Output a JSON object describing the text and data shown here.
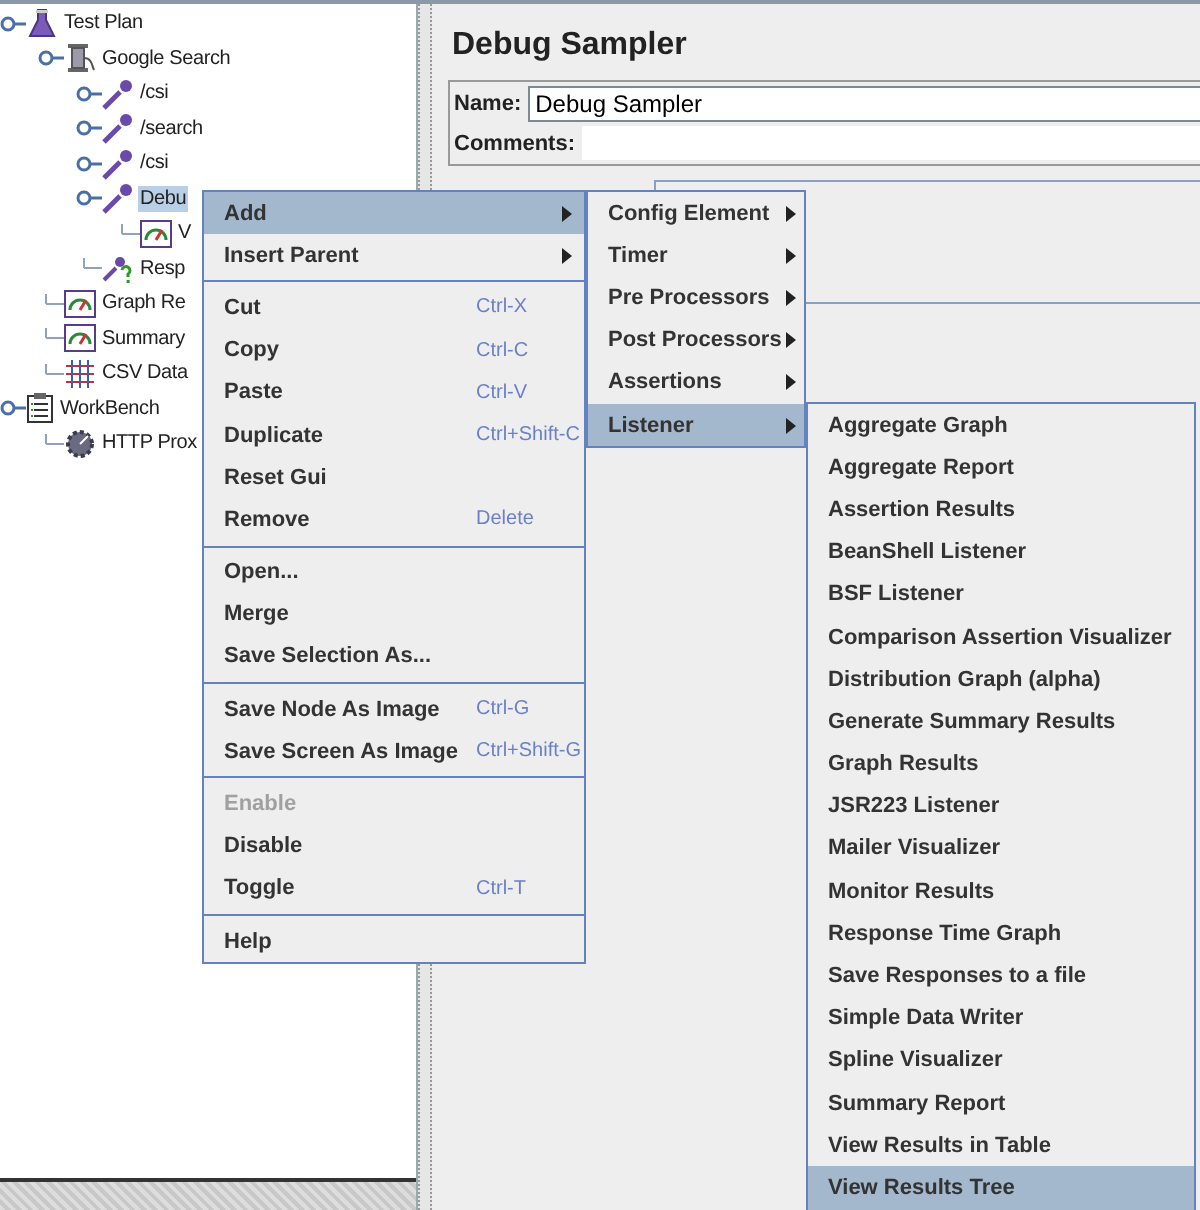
{
  "tree": [
    {
      "label": "Test Plan",
      "kind": "plan",
      "expandable": true,
      "selected": false,
      "children": [
        {
          "label": "Google Search",
          "kind": "thread-group",
          "expandable": true,
          "selected": false,
          "children": [
            {
              "label": "/csi",
              "kind": "sampler",
              "expandable": true,
              "selected": false
            },
            {
              "label": "/search",
              "kind": "sampler",
              "expandable": true,
              "selected": false
            },
            {
              "label": "/csi",
              "kind": "sampler",
              "expandable": true,
              "selected": false
            },
            {
              "label": "Debu",
              "kind": "sampler",
              "expandable": true,
              "selected": true,
              "children": [
                {
                  "label": "V",
                  "kind": "listener",
                  "expandable": false,
                  "selected": false
                }
              ]
            },
            {
              "label": "Resp",
              "kind": "assertion",
              "expandable": false,
              "selected": false
            }
          ]
        },
        {
          "label": "Graph Re",
          "kind": "listener",
          "expandable": false,
          "selected": false
        },
        {
          "label": "Summary",
          "kind": "listener",
          "expandable": false,
          "selected": false
        },
        {
          "label": "CSV Data",
          "kind": "config",
          "expandable": false,
          "selected": false
        }
      ]
    },
    {
      "label": "WorkBench",
      "kind": "workbench",
      "expandable": true,
      "selected": false,
      "children": [
        {
          "label": "HTTP Prox",
          "kind": "proxy",
          "expandable": false,
          "selected": false
        }
      ]
    }
  ],
  "editor": {
    "title": "Debug Sampler",
    "name_label": "Name:",
    "name_value": "Debug Sampler",
    "comments_label": "Comments:"
  },
  "context_menu": {
    "groups": [
      [
        {
          "label": "Add",
          "submenu": true,
          "disabled": false,
          "selected": true
        },
        {
          "label": "Insert Parent",
          "submenu": true,
          "disabled": false,
          "selected": false
        }
      ],
      [
        {
          "label": "Cut",
          "shortcut": "Ctrl-X",
          "submenu": false,
          "disabled": false,
          "selected": false
        },
        {
          "label": "Copy",
          "shortcut": "Ctrl-C",
          "submenu": false,
          "disabled": false,
          "selected": false
        },
        {
          "label": "Paste",
          "shortcut": "Ctrl-V",
          "submenu": false,
          "disabled": false,
          "selected": false
        },
        {
          "label": "Duplicate",
          "shortcut": "Ctrl+Shift-C",
          "submenu": false,
          "disabled": false,
          "selected": false
        },
        {
          "label": "Reset Gui",
          "submenu": false,
          "disabled": false,
          "selected": false
        },
        {
          "label": "Remove",
          "shortcut": "Delete",
          "submenu": false,
          "disabled": false,
          "selected": false
        }
      ],
      [
        {
          "label": "Open...",
          "submenu": false,
          "disabled": false,
          "selected": false
        },
        {
          "label": "Merge",
          "submenu": false,
          "disabled": false,
          "selected": false
        },
        {
          "label": "Save Selection As...",
          "submenu": false,
          "disabled": false,
          "selected": false
        }
      ],
      [
        {
          "label": "Save Node As Image",
          "shortcut": "Ctrl-G",
          "submenu": false,
          "disabled": false,
          "selected": false
        },
        {
          "label": "Save Screen As Image",
          "shortcut": "Ctrl+Shift-G",
          "submenu": false,
          "disabled": false,
          "selected": false
        }
      ],
      [
        {
          "label": "Enable",
          "submenu": false,
          "disabled": true,
          "selected": false
        },
        {
          "label": "Disable",
          "submenu": false,
          "disabled": false,
          "selected": false
        },
        {
          "label": "Toggle",
          "shortcut": "Ctrl-T",
          "submenu": false,
          "disabled": false,
          "selected": false
        }
      ],
      [
        {
          "label": "Help",
          "submenu": false,
          "disabled": false,
          "selected": false
        }
      ]
    ]
  },
  "add_submenu": {
    "items": [
      {
        "label": "Config Element",
        "selected": false
      },
      {
        "label": "Timer",
        "selected": false
      },
      {
        "label": "Pre Processors",
        "selected": false
      },
      {
        "label": "Post Processors",
        "selected": false
      },
      {
        "label": "Assertions",
        "selected": false
      },
      {
        "label": "Listener",
        "selected": true
      }
    ]
  },
  "listener_submenu": {
    "items": [
      {
        "label": "Aggregate Graph",
        "selected": false
      },
      {
        "label": "Aggregate Report",
        "selected": false
      },
      {
        "label": "Assertion Results",
        "selected": false
      },
      {
        "label": "BeanShell Listener",
        "selected": false
      },
      {
        "label": "BSF Listener",
        "selected": false
      },
      {
        "label": "Comparison Assertion Visualizer",
        "selected": false
      },
      {
        "label": "Distribution Graph (alpha)",
        "selected": false
      },
      {
        "label": "Generate Summary Results",
        "selected": false
      },
      {
        "label": "Graph Results",
        "selected": false
      },
      {
        "label": "JSR223 Listener",
        "selected": false
      },
      {
        "label": "Mailer Visualizer",
        "selected": false
      },
      {
        "label": "Monitor Results",
        "selected": false
      },
      {
        "label": "Response Time Graph",
        "selected": false
      },
      {
        "label": "Save Responses to a file",
        "selected": false
      },
      {
        "label": "Simple Data Writer",
        "selected": false
      },
      {
        "label": "Spline Visualizer",
        "selected": false
      },
      {
        "label": "Summary Report",
        "selected": false
      },
      {
        "label": "View Results in Table",
        "selected": false
      },
      {
        "label": "View Results Tree",
        "selected": true
      }
    ]
  }
}
